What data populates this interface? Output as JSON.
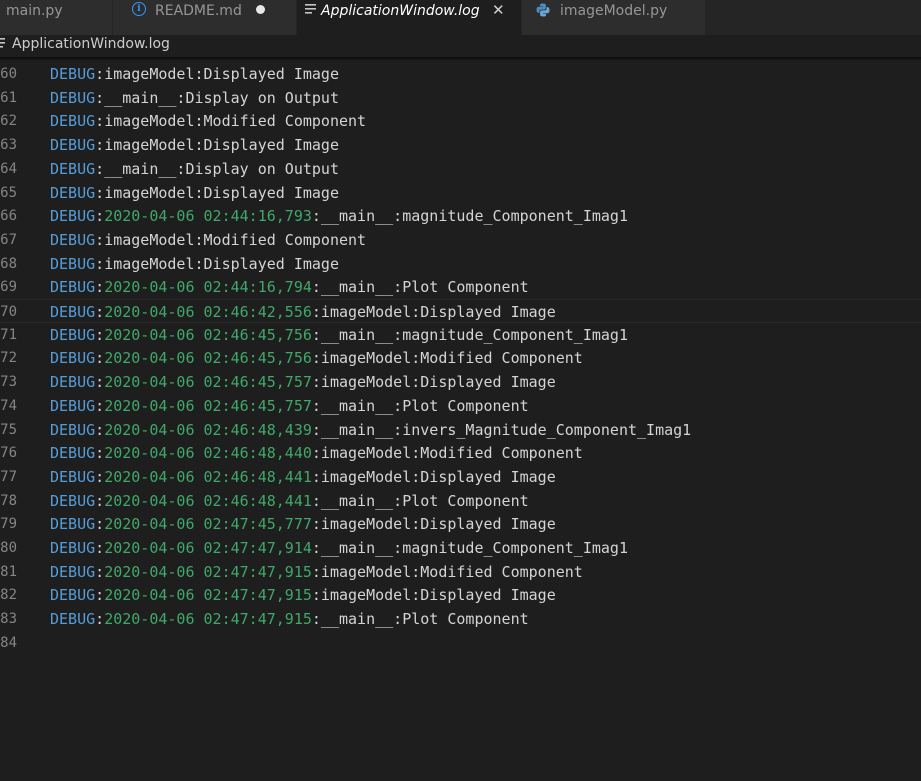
{
  "tabs": [
    {
      "label": "main.py",
      "active": false,
      "icon": "python-icon"
    },
    {
      "label": "README.md",
      "active": false,
      "icon": "info-icon",
      "dirty": true
    },
    {
      "label": "ApplicationWindow.log",
      "active": true,
      "icon": "lines-icon",
      "closable": true
    },
    {
      "label": "imageModel.py",
      "active": false,
      "icon": "python-icon"
    }
  ],
  "breadcrumb": {
    "file": "ApplicationWindow.log",
    "icon": "lines-icon"
  },
  "colors": {
    "level": "#569cd6",
    "timestamp": "#3fa86a",
    "text": "#d4d4d4",
    "line_number": "#858585",
    "background": "#1e1e1e"
  },
  "editor": {
    "lines": [
      {
        "n": "60",
        "level": "DEBUG",
        "sep": ":",
        "time": "",
        "msg": "imageModel:Displayed Image"
      },
      {
        "n": "61",
        "level": "DEBUG",
        "sep": ":",
        "time": "",
        "msg": "__main__:Display on Output"
      },
      {
        "n": "62",
        "level": "DEBUG",
        "sep": ":",
        "time": "",
        "msg": "imageModel:Modified Component"
      },
      {
        "n": "63",
        "level": "DEBUG",
        "sep": ":",
        "time": "",
        "msg": "imageModel:Displayed Image"
      },
      {
        "n": "64",
        "level": "DEBUG",
        "sep": ":",
        "time": "",
        "msg": "__main__:Display on Output"
      },
      {
        "n": "65",
        "level": "DEBUG",
        "sep": ":",
        "time": "",
        "msg": "imageModel:Displayed Image"
      },
      {
        "n": "66",
        "level": "DEBUG",
        "sep": ":",
        "time": "2020-04-06 02:44:16,793",
        "msg": ":__main__:magnitude_Component_Imag1"
      },
      {
        "n": "67",
        "level": "DEBUG",
        "sep": ":",
        "time": "",
        "msg": "imageModel:Modified Component"
      },
      {
        "n": "68",
        "level": "DEBUG",
        "sep": ":",
        "time": "",
        "msg": "imageModel:Displayed Image"
      },
      {
        "n": "69",
        "level": "DEBUG",
        "sep": ":",
        "time": "2020-04-06 02:44:16,794",
        "msg": ":__main__:Plot Component"
      },
      {
        "n": "70",
        "level": "DEBUG",
        "sep": ":",
        "time": "2020-04-06 02:46:42,556",
        "msg": ":imageModel:Displayed Image",
        "current": true
      },
      {
        "n": "71",
        "level": "DEBUG",
        "sep": ":",
        "time": "2020-04-06 02:46:45,756",
        "msg": ":__main__:magnitude_Component_Imag1"
      },
      {
        "n": "72",
        "level": "DEBUG",
        "sep": ":",
        "time": "2020-04-06 02:46:45,756",
        "msg": ":imageModel:Modified Component"
      },
      {
        "n": "73",
        "level": "DEBUG",
        "sep": ":",
        "time": "2020-04-06 02:46:45,757",
        "msg": ":imageModel:Displayed Image"
      },
      {
        "n": "74",
        "level": "DEBUG",
        "sep": ":",
        "time": "2020-04-06 02:46:45,757",
        "msg": ":__main__:Plot Component"
      },
      {
        "n": "75",
        "level": "DEBUG",
        "sep": ":",
        "time": "2020-04-06 02:46:48,439",
        "msg": ":__main__:invers_Magnitude_Component_Imag1"
      },
      {
        "n": "76",
        "level": "DEBUG",
        "sep": ":",
        "time": "2020-04-06 02:46:48,440",
        "msg": ":imageModel:Modified Component"
      },
      {
        "n": "77",
        "level": "DEBUG",
        "sep": ":",
        "time": "2020-04-06 02:46:48,441",
        "msg": ":imageModel:Displayed Image"
      },
      {
        "n": "78",
        "level": "DEBUG",
        "sep": ":",
        "time": "2020-04-06 02:46:48,441",
        "msg": ":__main__:Plot Component"
      },
      {
        "n": "79",
        "level": "DEBUG",
        "sep": ":",
        "time": "2020-04-06 02:47:45,777",
        "msg": ":imageModel:Displayed Image"
      },
      {
        "n": "80",
        "level": "DEBUG",
        "sep": ":",
        "time": "2020-04-06 02:47:47,914",
        "msg": ":__main__:magnitude_Component_Imag1"
      },
      {
        "n": "81",
        "level": "DEBUG",
        "sep": ":",
        "time": "2020-04-06 02:47:47,915",
        "msg": ":imageModel:Modified Component"
      },
      {
        "n": "82",
        "level": "DEBUG",
        "sep": ":",
        "time": "2020-04-06 02:47:47,915",
        "msg": ":imageModel:Displayed Image"
      },
      {
        "n": "83",
        "level": "DEBUG",
        "sep": ":",
        "time": "2020-04-06 02:47:47,915",
        "msg": ":__main__:Plot Component"
      },
      {
        "n": "84",
        "level": "",
        "sep": "",
        "time": "",
        "msg": ""
      }
    ]
  }
}
